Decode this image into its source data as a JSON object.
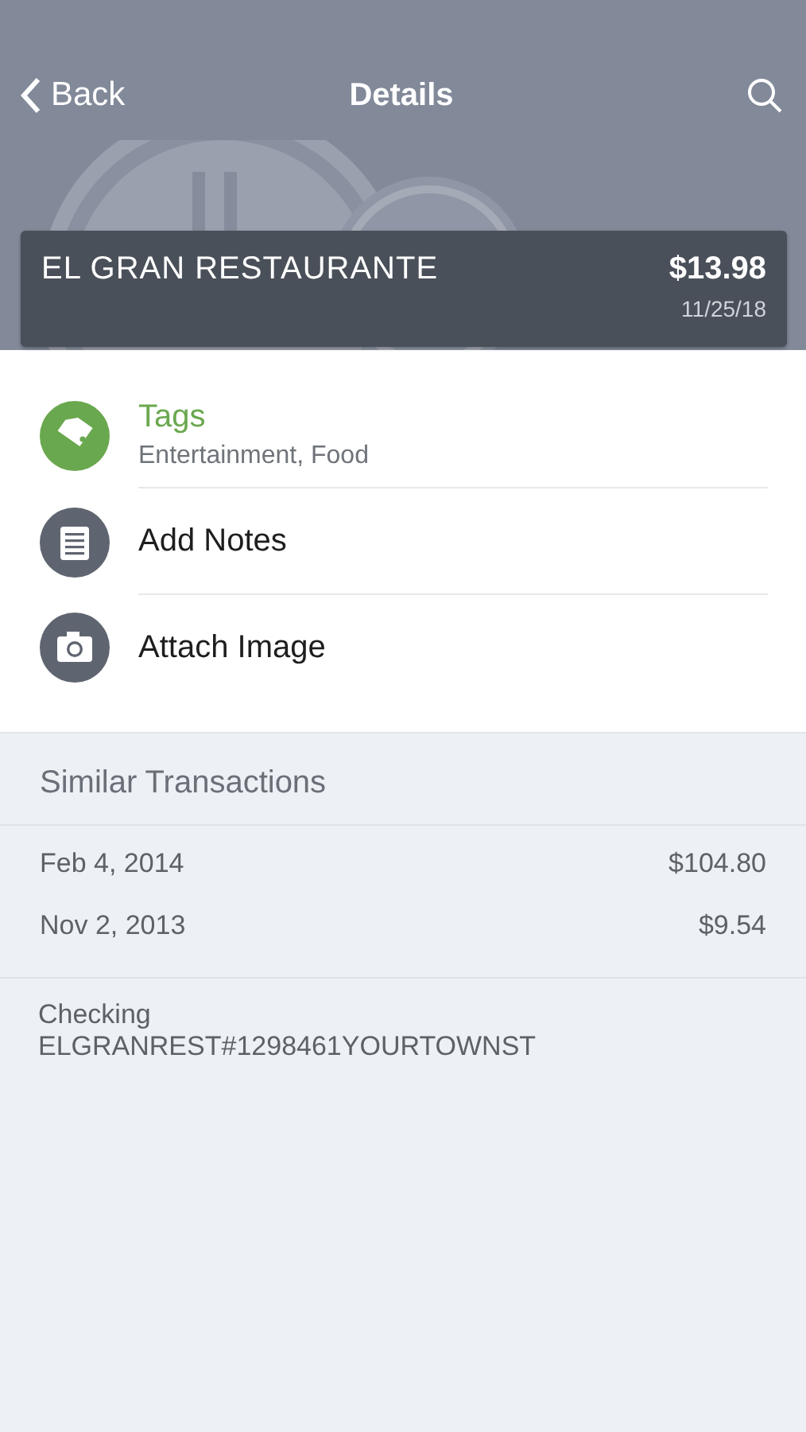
{
  "nav": {
    "back": "Back",
    "title": "Details"
  },
  "transaction": {
    "merchant": "EL GRAN RESTAURANTE",
    "amount": "$13.98",
    "date": "11/25/18"
  },
  "actions": [
    {
      "kind": "tags",
      "label": "Tags",
      "detail": "Entertainment, Food"
    },
    {
      "kind": "notes",
      "label": "Add Notes"
    },
    {
      "label": "Attach Image"
    }
  ],
  "similar": {
    "title": "Similar Transactions",
    "rows": [
      {
        "date": "Feb 4, 2014",
        "amount": "$104.80"
      },
      {
        "date": "Nov 2, 2013",
        "amount": "$9.54"
      }
    ]
  },
  "account": {
    "name": "Checking",
    "description": "ELGRANREST#1298461YOURTOWNST"
  }
}
